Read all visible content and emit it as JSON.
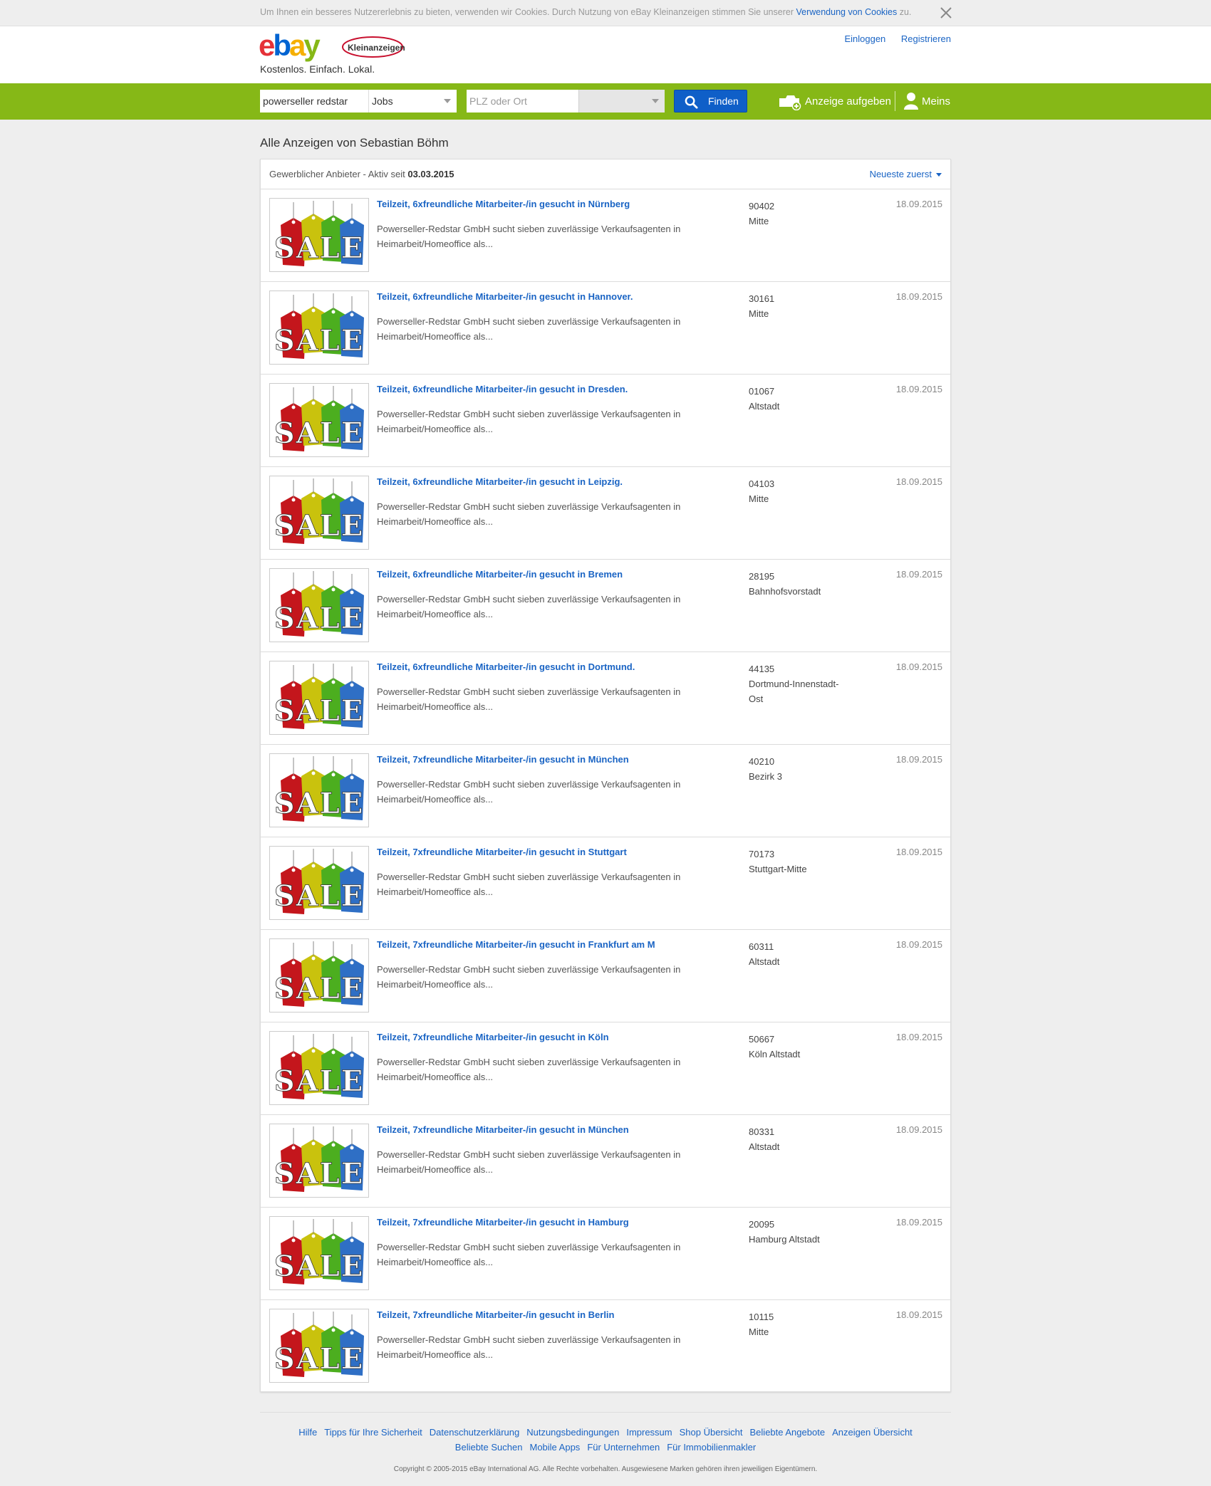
{
  "cookie_bar": {
    "text": "Um Ihnen ein besseres Nutzererlebnis zu bieten, verwenden wir Cookies. Durch Nutzung von eBay Kleinanzeigen stimmen Sie unserer",
    "link": "Verwendung von Cookies",
    "suffix": " zu."
  },
  "header": {
    "logo_word": "ebay",
    "logo_badge": "Kleinanzeigen",
    "tagline": "Kostenlos. Einfach. Lokal.",
    "login": "Einloggen",
    "register": "Registrieren"
  },
  "search": {
    "query": "powerseller redstar",
    "category": "Jobs",
    "location_placeholder": "PLZ oder Ort",
    "find_label": "Finden",
    "post_ad_label": "Anzeige aufgeben",
    "meins_label": "Meins"
  },
  "colors": {
    "brand_green": "#86b817",
    "link_blue": "#1a64c4",
    "find_button": "#0f5fc8"
  },
  "page": {
    "title": "Alle Anzeigen von Sebastian Böhm",
    "seller_prefix": "Gewerblicher Anbieter - Aktiv seit ",
    "seller_since": "03.03.2015",
    "sort_label": "Neueste zuerst"
  },
  "ads": [
    {
      "title": "Teilzeit, 6xfreundliche Mitarbeiter-/in gesucht in Nürnberg",
      "desc": "Powerseller-Redstar GmbH sucht sieben zuverlässige Verkaufsagenten in Heimarbeit/Homeoffice als...",
      "zip": "90402",
      "district": "Mitte",
      "date": "18.09.2015",
      "thumb_text": "SALE"
    },
    {
      "title": "Teilzeit, 6xfreundliche Mitarbeiter-/in gesucht in Hannover.",
      "desc": "Powerseller-Redstar GmbH sucht sieben zuverlässige Verkaufsagenten in Heimarbeit/Homeoffice als...",
      "zip": "30161",
      "district": "Mitte",
      "date": "18.09.2015",
      "thumb_text": "SALE"
    },
    {
      "title": "Teilzeit, 6xfreundliche Mitarbeiter-/in gesucht in Dresden.",
      "desc": "Powerseller-Redstar GmbH sucht sieben zuverlässige Verkaufsagenten in Heimarbeit/Homeoffice als...",
      "zip": "01067",
      "district": "Altstadt",
      "date": "18.09.2015",
      "thumb_text": "SALE"
    },
    {
      "title": "Teilzeit, 6xfreundliche Mitarbeiter-/in gesucht in Leipzig.",
      "desc": "Powerseller-Redstar GmbH sucht sieben zuverlässige Verkaufsagenten in Heimarbeit/Homeoffice als...",
      "zip": "04103",
      "district": "Mitte",
      "date": "18.09.2015",
      "thumb_text": "SALE"
    },
    {
      "title": "Teilzeit, 6xfreundliche Mitarbeiter-/in gesucht in Bremen",
      "desc": "Powerseller-Redstar GmbH sucht sieben zuverlässige Verkaufsagenten in Heimarbeit/Homeoffice als...",
      "zip": "28195",
      "district": "Bahnhofsvorstadt",
      "date": "18.09.2015",
      "thumb_text": "SALE"
    },
    {
      "title": "Teilzeit, 6xfreundliche Mitarbeiter-/in gesucht in Dortmund.",
      "desc": "Powerseller-Redstar GmbH sucht sieben zuverlässige Verkaufsagenten in Heimarbeit/Homeoffice als...",
      "zip": "44135",
      "district": "Dortmund-Innenstadt-Ost",
      "date": "18.09.2015",
      "thumb_text": "SALE"
    },
    {
      "title": "Teilzeit, 7xfreundliche Mitarbeiter-/in gesucht in München",
      "desc": "Powerseller-Redstar GmbH sucht sieben zuverlässige Verkaufsagenten in Heimarbeit/Homeoffice als...",
      "zip": "40210",
      "district": "Bezirk 3",
      "date": "18.09.2015",
      "thumb_text": "SALE"
    },
    {
      "title": "Teilzeit, 7xfreundliche Mitarbeiter-/in gesucht in Stuttgart",
      "desc": "Powerseller-Redstar GmbH sucht sieben zuverlässige Verkaufsagenten in Heimarbeit/Homeoffice als...",
      "zip": "70173",
      "district": "Stuttgart-Mitte",
      "date": "18.09.2015",
      "thumb_text": "SALE"
    },
    {
      "title": "Teilzeit, 7xfreundliche Mitarbeiter-/in gesucht in Frankfurt am M",
      "desc": "Powerseller-Redstar GmbH sucht sieben zuverlässige Verkaufsagenten in Heimarbeit/Homeoffice als...",
      "zip": "60311",
      "district": "Altstadt",
      "date": "18.09.2015",
      "thumb_text": "SALE"
    },
    {
      "title": "Teilzeit, 7xfreundliche Mitarbeiter-/in gesucht in Köln",
      "desc": "Powerseller-Redstar GmbH sucht sieben zuverlässige Verkaufsagenten in Heimarbeit/Homeoffice als...",
      "zip": "50667",
      "district": "Köln Altstadt",
      "date": "18.09.2015",
      "thumb_text": "SALE"
    },
    {
      "title": "Teilzeit, 7xfreundliche Mitarbeiter-/in gesucht in München",
      "desc": "Powerseller-Redstar GmbH sucht sieben zuverlässige Verkaufsagenten in Heimarbeit/Homeoffice als...",
      "zip": "80331",
      "district": "Altstadt",
      "date": "18.09.2015",
      "thumb_text": "SALE"
    },
    {
      "title": "Teilzeit, 7xfreundliche Mitarbeiter-/in gesucht in Hamburg",
      "desc": "Powerseller-Redstar GmbH sucht sieben zuverlässige Verkaufsagenten in Heimarbeit/Homeoffice als...",
      "zip": "20095",
      "district": "Hamburg Altstadt",
      "date": "18.09.2015",
      "thumb_text": "SALE"
    },
    {
      "title": "Teilzeit, 7xfreundliche Mitarbeiter-/in gesucht in Berlin",
      "desc": "Powerseller-Redstar GmbH sucht sieben zuverlässige Verkaufsagenten in Heimarbeit/Homeoffice als...",
      "zip": "10115",
      "district": "Mitte",
      "date": "18.09.2015",
      "thumb_text": "SALE"
    }
  ],
  "footer": {
    "links_row1": [
      "Hilfe",
      "Tipps für Ihre Sicherheit",
      "Datenschutzerklärung",
      "Nutzungsbedingungen",
      "Impressum",
      "Shop Übersicht",
      "Beliebte Angebote",
      "Anzeigen Übersicht"
    ],
    "links_row2": [
      "Beliebte Suchen",
      "Mobile Apps",
      "Für Unternehmen",
      "Für Immobilienmakler"
    ],
    "copyright": "Copyright © 2005-2015 eBay International AG. Alle Rechte vorbehalten. Ausgewiesene Marken gehören ihren jeweiligen Eigentümern."
  }
}
